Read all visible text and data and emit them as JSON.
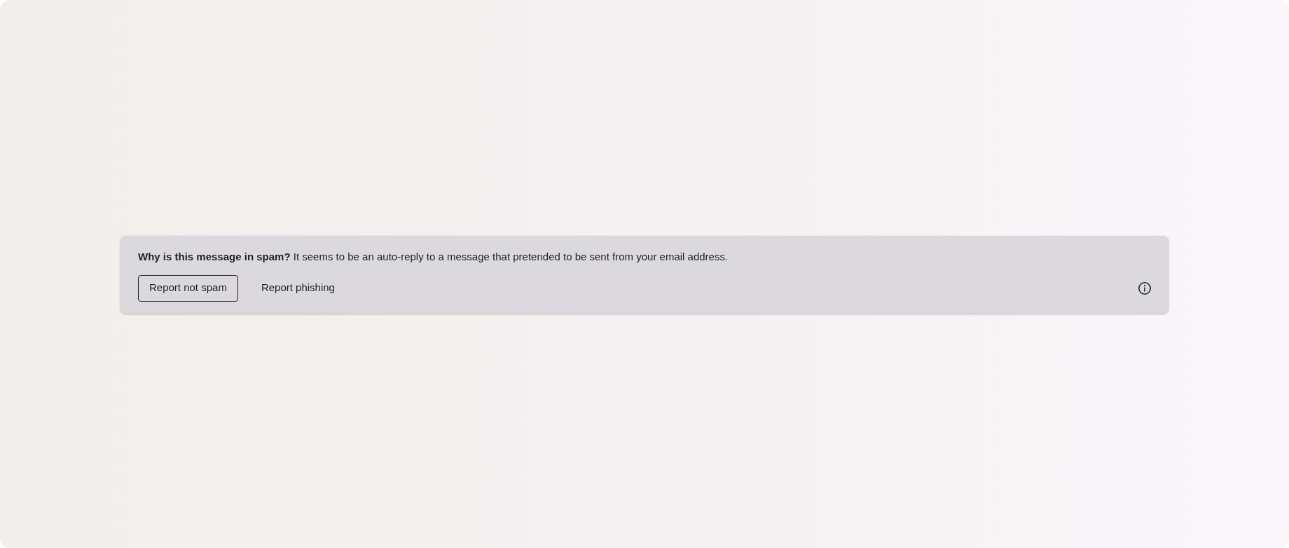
{
  "banner": {
    "message": "**Why is this message in spam?** It seems to be an auto-reply to a message that pretended to be sent from your email address.",
    "buttons": [
      {
        "label": "Report not spam",
        "kind": "outlined"
      },
      {
        "label": "Report phishing",
        "kind": "text"
      }
    ]
  }
}
